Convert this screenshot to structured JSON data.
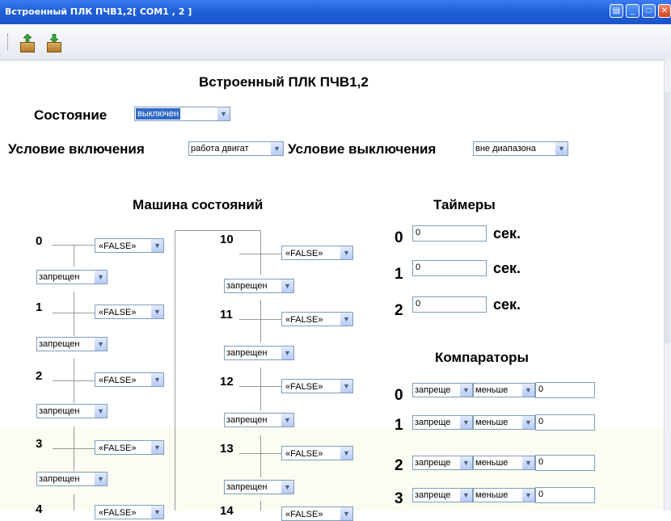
{
  "window": {
    "title": "Встроенный ПЛК ПЧВ1,2[ COM1 , 2 ]"
  },
  "page": {
    "title": "Встроенный ПЛК ПЧВ1,2",
    "state_label": "Состояние",
    "state_value": "выключен",
    "on_condition_label": "Условие включения",
    "on_condition_value": "работа двигат",
    "off_condition_label": "Условие выключения",
    "off_condition_value": "вне диапазона"
  },
  "state_machine": {
    "title": "Машина состояний",
    "left": [
      {
        "index": "0",
        "condition": "«FALSE»",
        "mode": "запрещен"
      },
      {
        "index": "1",
        "condition": "«FALSE»",
        "mode": "запрещен"
      },
      {
        "index": "2",
        "condition": "«FALSE»",
        "mode": "запрещен"
      },
      {
        "index": "3",
        "condition": "«FALSE»",
        "mode": "запрещен"
      },
      {
        "index": "4",
        "condition": "«FALSE»",
        "mode": ""
      }
    ],
    "right": [
      {
        "index": "10",
        "condition": "«FALSE»",
        "mode": "запрещен"
      },
      {
        "index": "11",
        "condition": "«FALSE»",
        "mode": "запрещен"
      },
      {
        "index": "12",
        "condition": "«FALSE»",
        "mode": "запрещен"
      },
      {
        "index": "13",
        "condition": "«FALSE»",
        "mode": "запрещен"
      },
      {
        "index": "14",
        "condition": "«FALSE»",
        "mode": ""
      }
    ]
  },
  "timers": {
    "title": "Таймеры",
    "unit": "сек.",
    "items": [
      {
        "index": "0",
        "value": "0"
      },
      {
        "index": "1",
        "value": "0"
      },
      {
        "index": "2",
        "value": "0"
      }
    ]
  },
  "comparators": {
    "title": "Компараторы",
    "items": [
      {
        "index": "0",
        "mode": "запреще",
        "op": "меньше",
        "value": "0"
      },
      {
        "index": "1",
        "mode": "запреще",
        "op": "меньше",
        "value": "0"
      },
      {
        "index": "2",
        "mode": "запреще",
        "op": "меньше",
        "value": "0"
      },
      {
        "index": "3",
        "mode": "запреще",
        "op": "меньше",
        "value": "0"
      }
    ]
  },
  "icons": {
    "upload": "box-up-arrow-icon",
    "download": "box-down-arrow-icon"
  },
  "colors": {
    "titlebar": "#1f5fd8",
    "selection": "#316ac5"
  }
}
